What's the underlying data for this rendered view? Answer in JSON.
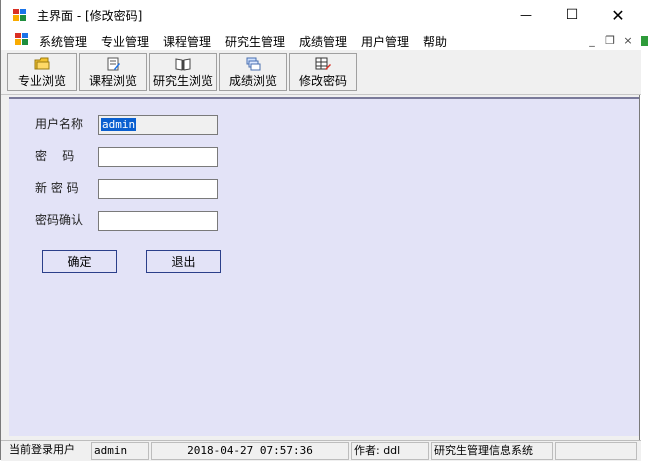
{
  "window": {
    "title": "主界面 - [修改密码]",
    "minimize_glyph": "—",
    "maximize_glyph": "☐",
    "close_glyph": "✕"
  },
  "menubar": {
    "items": [
      "系统管理",
      "专业管理",
      "课程管理",
      "研究生管理",
      "成绩管理",
      "用户管理",
      "帮助"
    ],
    "mdi_minimize": "_",
    "mdi_restore": "❐",
    "mdi_close": "×"
  },
  "toolbar": {
    "buttons": [
      {
        "label": "专业浏览",
        "icon": "folder-icon"
      },
      {
        "label": "课程浏览",
        "icon": "edit-document-icon"
      },
      {
        "label": "研究生浏览",
        "icon": "book-icon"
      },
      {
        "label": "成绩浏览",
        "icon": "stack-documents-icon"
      },
      {
        "label": "修改密码",
        "icon": "grid-edit-icon"
      }
    ]
  },
  "form": {
    "username_label": "用户名称",
    "username_value": "admin",
    "password_label": "密    码",
    "password_value": "",
    "new_password_label": "新 密 码",
    "new_password_value": "",
    "confirm_label": "密码确认",
    "confirm_value": "",
    "ok_label": "确定",
    "exit_label": "退出"
  },
  "status": {
    "login_label": "当前登录用户",
    "user": "admin",
    "datetime": "2018-04-27 07:57:36",
    "author": "作者: ddl",
    "system_name": "研究生管理信息系统"
  },
  "colors": {
    "content_bg": "#e3e3f7",
    "selection": "#0a5fd0",
    "button_border": "#2b3f8a"
  }
}
